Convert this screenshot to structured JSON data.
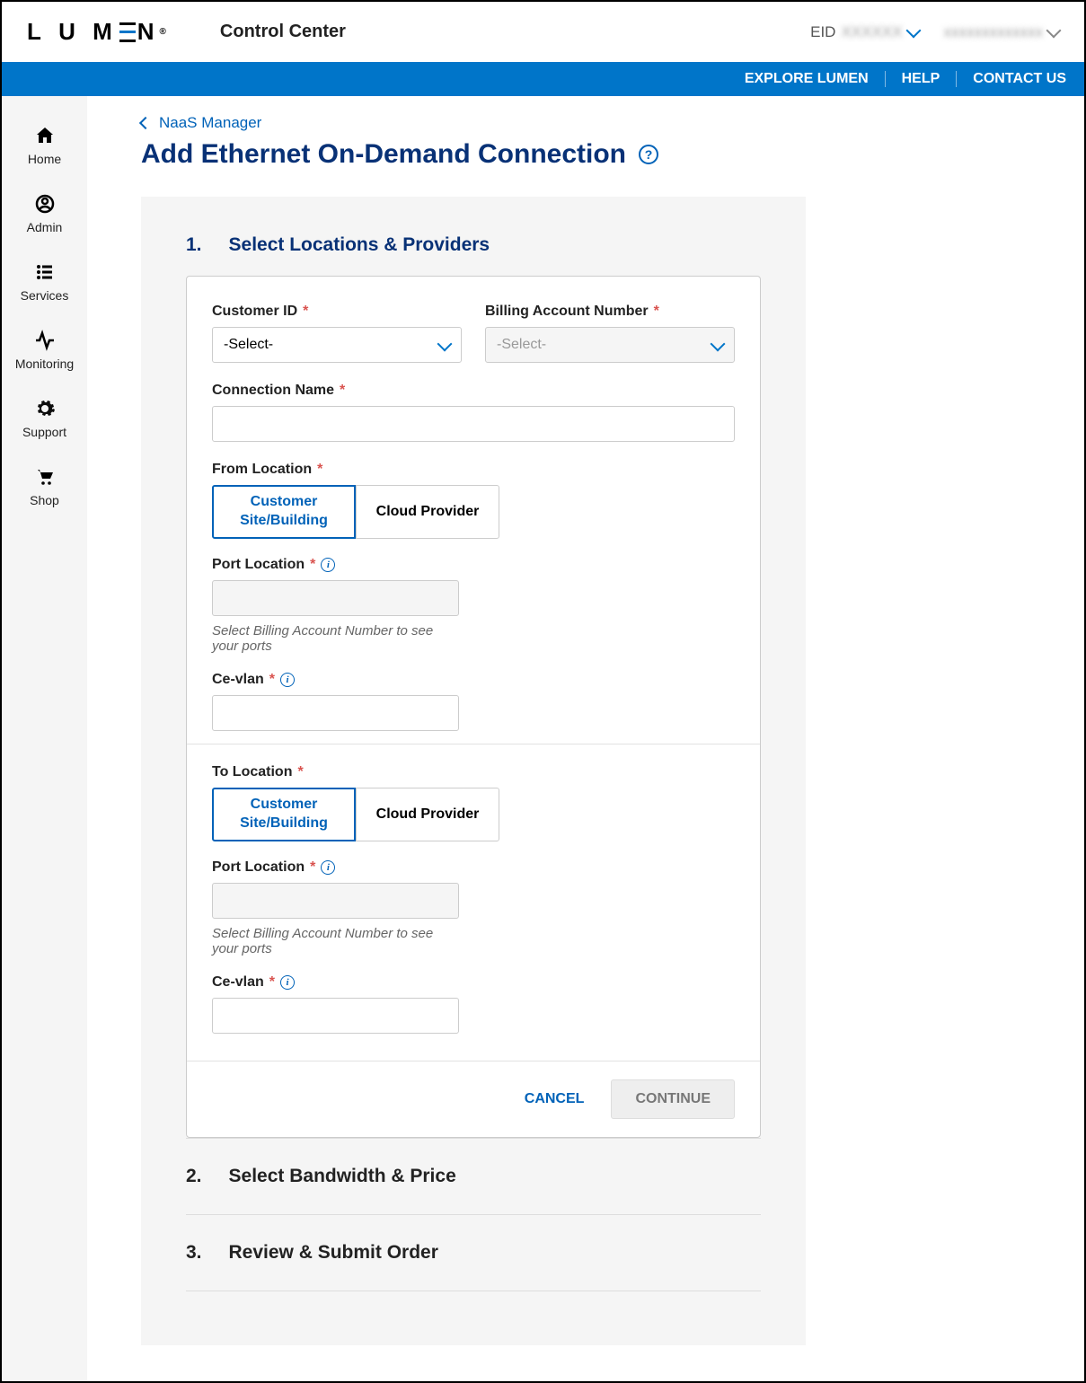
{
  "brand": {
    "name": "LUMEN",
    "app": "Control Center"
  },
  "topbar": {
    "eid_label": "EID",
    "eid_value": "XXXXXX",
    "account_value": "xxxxxxxxxxxxx"
  },
  "bluebar": {
    "explore": "EXPLORE LUMEN",
    "help": "HELP",
    "contact": "CONTACT US"
  },
  "sidebar": {
    "items": [
      {
        "label": "Home",
        "icon": "home-icon"
      },
      {
        "label": "Admin",
        "icon": "user-icon"
      },
      {
        "label": "Services",
        "icon": "list-icon"
      },
      {
        "label": "Monitoring",
        "icon": "activity-icon"
      },
      {
        "label": "Support",
        "icon": "gear-icon"
      },
      {
        "label": "Shop",
        "icon": "cart-icon"
      }
    ]
  },
  "breadcrumb": {
    "parent": "NaaS Manager"
  },
  "page": {
    "title": "Add Ethernet On-Demand Connection"
  },
  "wizard": {
    "step1_num": "1.",
    "step1_title": "Select Locations & Providers",
    "step2_num": "2.",
    "step2_title": "Select Bandwidth & Price",
    "step3_num": "3.",
    "step3_title": "Review & Submit Order"
  },
  "form": {
    "customer_id_label": "Customer ID",
    "customer_id_value": "-Select-",
    "billing_label": "Billing Account Number",
    "billing_value": "-Select-",
    "connection_name_label": "Connection Name",
    "from_location_label": "From Location",
    "to_location_label": "To Location",
    "toggle_customer": "Customer Site/Building",
    "toggle_cloud": "Cloud Provider",
    "port_location_label": "Port Location",
    "port_hint": "Select Billing Account Number to see your ports",
    "cevlan_label": "Ce-vlan",
    "cancel": "CANCEL",
    "continue": "CONTINUE"
  }
}
